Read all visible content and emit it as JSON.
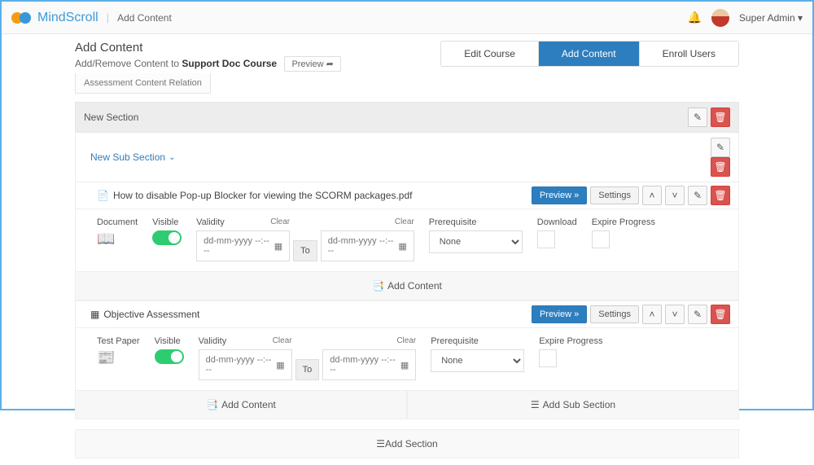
{
  "header": {
    "brand": "MindScroll",
    "breadcrumb": "Add Content",
    "user_label": "Super Admin"
  },
  "page": {
    "title": "Add Content",
    "subtitle_prefix": "Add/Remove Content to ",
    "course_name": "Support Doc Course",
    "preview_btn": "Preview",
    "tabs": {
      "edit": "Edit Course",
      "add": "Add Content",
      "enroll": "Enroll Users"
    },
    "orphan_tab": "Assessment Content Relation"
  },
  "section": {
    "name": "New Section"
  },
  "subsection": {
    "name": "New Sub Section"
  },
  "item1": {
    "title": "How to disable Pop-up Blocker for viewing the SCORM packages.pdf",
    "preview": "Preview",
    "settings": "Settings",
    "type_label": "Document",
    "visible_label": "Visible",
    "validity_label": "Validity",
    "clear": "Clear",
    "date_placeholder": "dd-mm-yyyy --:-- --",
    "to": "To",
    "prereq_label": "Prerequisite",
    "prereq_value": "None",
    "download_label": "Download",
    "expire_label": "Expire Progress"
  },
  "item2": {
    "title": "Objective Assessment",
    "preview": "Preview",
    "settings": "Settings",
    "type_label": "Test Paper",
    "visible_label": "Visible",
    "validity_label": "Validity",
    "clear": "Clear",
    "date_placeholder": "dd-mm-yyyy --:-- --",
    "to": "To",
    "prereq_label": "Prerequisite",
    "prereq_value": "None",
    "expire_label": "Expire Progress"
  },
  "buttons": {
    "add_content": "Add Content",
    "add_subsection": "Add Sub Section",
    "add_section": "Add Section"
  }
}
